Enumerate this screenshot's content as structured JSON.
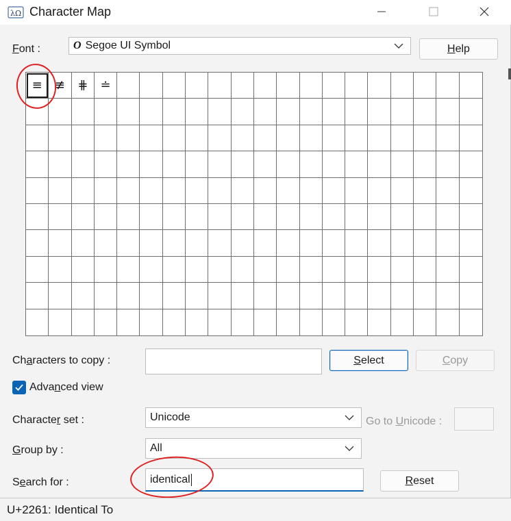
{
  "window": {
    "title": "Character Map"
  },
  "font_label": "Font :",
  "font_combo": {
    "value": "Segoe UI Symbol",
    "font_glyph": "O"
  },
  "help_button": "Help",
  "grid": {
    "cells": [
      "≡",
      "≢",
      "⋕",
      "≐",
      "",
      "",
      "",
      "",
      "",
      "",
      "",
      "",
      "",
      "",
      "",
      "",
      "",
      "",
      "",
      ""
    ]
  },
  "chars_to_copy": {
    "label": "Characters to copy :",
    "value": ""
  },
  "select_button": "Select",
  "copy_button": "Copy",
  "advanced_view": {
    "label": "Advanced view",
    "checked": true
  },
  "character_set": {
    "label": "Character set :",
    "value": "Unicode"
  },
  "goto_unicode": {
    "label": "Go to Unicode :",
    "value": ""
  },
  "group_by": {
    "label": "Group by :",
    "value": "All"
  },
  "search_for": {
    "label": "Search for :",
    "value": "identical"
  },
  "reset_button": "Reset",
  "status": "U+2261: Identical To",
  "colors": {
    "accent": "#0a64b4",
    "annotation": "#e02020"
  }
}
